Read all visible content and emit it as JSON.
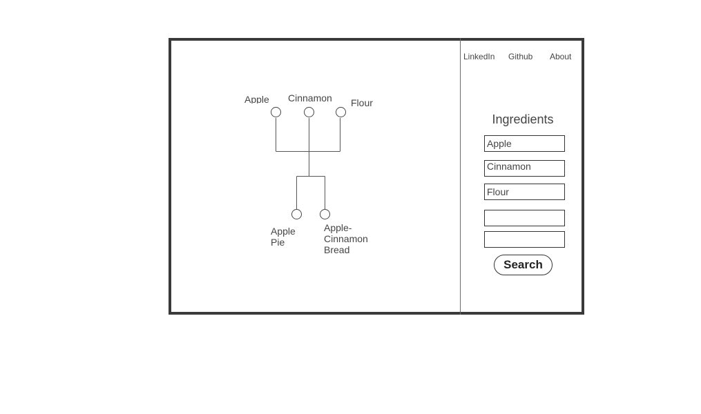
{
  "nav": {
    "links": [
      {
        "label": "LinkedIn"
      },
      {
        "label": "Github"
      },
      {
        "label": "About"
      }
    ]
  },
  "panel": {
    "title": "Ingredients",
    "inputs": [
      {
        "value": "Apple",
        "placeholder": ""
      },
      {
        "value": "Cinnamon",
        "placeholder": ""
      },
      {
        "value": "Flour",
        "placeholder": ""
      },
      {
        "value": "",
        "placeholder": ""
      },
      {
        "value": "",
        "placeholder": ""
      }
    ],
    "search_label": "Search"
  },
  "graph": {
    "ingredients": [
      {
        "label": "Apple"
      },
      {
        "label": "Cinnamon"
      },
      {
        "label": "Flour"
      }
    ],
    "recipes": [
      {
        "label": "Apple Pie"
      },
      {
        "label": "Apple-Cinnamon Bread"
      }
    ]
  }
}
